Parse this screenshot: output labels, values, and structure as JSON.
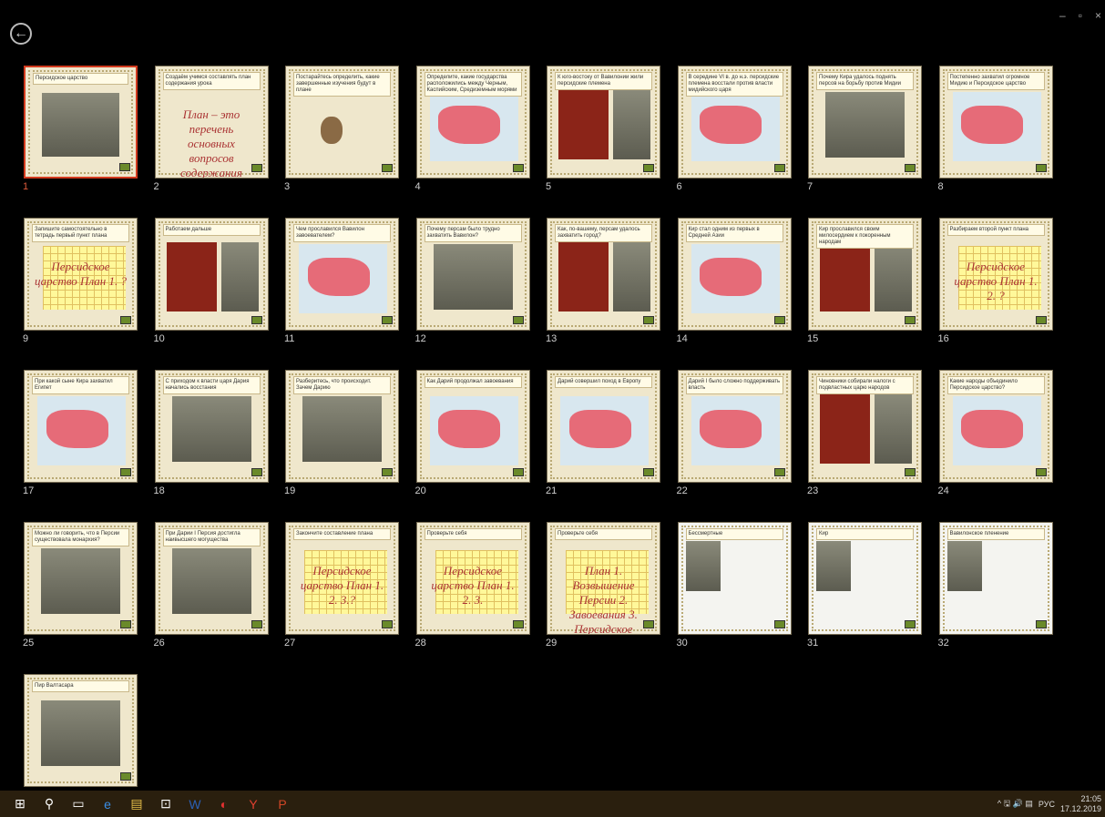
{
  "window": {
    "back_icon": "back-arrow-icon",
    "controls": [
      "–",
      "▫",
      "×"
    ]
  },
  "slides": [
    {
      "n": "1",
      "t": "Персидское царство",
      "k": "photo",
      "sel": true
    },
    {
      "n": "2",
      "t": "Создаём учимся составлять план содержания урока",
      "k": "text",
      "big": "План – это перечень основных вопросов содержания темы"
    },
    {
      "n": "3",
      "t": "Постарайтесь определить, какие завершенные изучения будут в плане",
      "k": "owl"
    },
    {
      "n": "4",
      "t": "Определите, какие государства расположились между Черным, Каспийским, Средиземным морями",
      "k": "map"
    },
    {
      "n": "5",
      "t": "К юго-востоку от Вавилонии жили персидские племена",
      "k": "red"
    },
    {
      "n": "6",
      "t": "В середине VI в. до н.э. персидские племена восстали против власти мидийского царя",
      "k": "map"
    },
    {
      "n": "7",
      "t": "Почему Кира удалось поднять персов на борьбу против Мидии",
      "k": "photo"
    },
    {
      "n": "8",
      "t": "Постепенно захватил огромное Мидию и Персидское царство",
      "k": "map"
    },
    {
      "n": "9",
      "t": "Запишите самостоятельно в тетрадь первый пункт плана",
      "k": "grid",
      "big": "Персидское царство План 1. ?"
    },
    {
      "n": "10",
      "t": "Работаем дальше",
      "k": "red"
    },
    {
      "n": "11",
      "t": "Чем прославился Вавилон завоевателем?",
      "k": "map"
    },
    {
      "n": "12",
      "t": "Почему персам было трудно захватить Вавилон?",
      "k": "photo"
    },
    {
      "n": "13",
      "t": "Как, по-вашему, персам удалось захватить город?",
      "k": "red"
    },
    {
      "n": "14",
      "t": "Кир стал одним из первых в Средней Азии",
      "k": "map"
    },
    {
      "n": "15",
      "t": "Кир прославился своим милосердием к покоренным народам",
      "k": "red"
    },
    {
      "n": "16",
      "t": "Разбираем второй пункт плана",
      "k": "grid",
      "big": "Персидское царство План 1. 2. ?"
    },
    {
      "n": "17",
      "t": "При какой сыне Кира захватил Египет",
      "k": "map"
    },
    {
      "n": "18",
      "t": "С приходом к власти царя Дария начались восстания",
      "k": "photo"
    },
    {
      "n": "19",
      "t": "Разберитесь, что происходит. Зачем Дарию",
      "k": "photo"
    },
    {
      "n": "20",
      "t": "Как Дарий продолжал завоевания",
      "k": "map"
    },
    {
      "n": "21",
      "t": "Дарий совершил поход в Европу",
      "k": "map"
    },
    {
      "n": "22",
      "t": "Дарий I было сложно поддерживать власть",
      "k": "map"
    },
    {
      "n": "23",
      "t": "Чиновники собирали налоги с подвластных царю народов",
      "k": "red"
    },
    {
      "n": "24",
      "t": "Какие народы объединило Персидское царство?",
      "k": "map"
    },
    {
      "n": "25",
      "t": "Можно ли говорить, что в Персии существовала монархия?",
      "k": "photo"
    },
    {
      "n": "26",
      "t": "При Дарии I Персия достигла наивысшего могущества",
      "k": "photo"
    },
    {
      "n": "27",
      "t": "Закончите составление плана",
      "k": "grid",
      "big": "Персидское царство План 1. 2. 3.?"
    },
    {
      "n": "28",
      "t": "Проверьте себя",
      "k": "grid",
      "big": "Персидское царство План 1. 2. 3."
    },
    {
      "n": "29",
      "t": "Проверьте себя",
      "k": "grid",
      "big": "План 1. Возвышение Персии 2. Завоевания 3. Персидское государство"
    },
    {
      "n": "30",
      "t": "Бессмертные",
      "k": "plain"
    },
    {
      "n": "31",
      "t": "Кир",
      "k": "plain"
    },
    {
      "n": "32",
      "t": "Вавилонское пленение",
      "k": "plain"
    },
    {
      "n": "33",
      "t": "Пир Валтасара",
      "k": "photo"
    }
  ],
  "taskbar": {
    "icons": [
      "windows-start-icon",
      "search-icon",
      "task-view-icon",
      "edge-icon",
      "file-explorer-icon",
      "store-icon",
      "word-icon",
      "app-icon",
      "yandex-icon",
      "powerpoint-icon"
    ],
    "lang": "РУС",
    "time": "21:05",
    "date": "17.12.2019"
  }
}
